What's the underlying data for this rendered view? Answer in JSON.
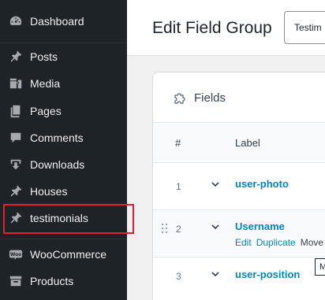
{
  "sidebar": {
    "items": [
      {
        "label": "Dashboard",
        "icon": "dashboard-icon"
      },
      {
        "label": "Posts",
        "icon": "pin-icon"
      },
      {
        "label": "Media",
        "icon": "media-icon"
      },
      {
        "label": "Pages",
        "icon": "pages-icon"
      },
      {
        "label": "Comments",
        "icon": "comment-icon"
      },
      {
        "label": "Downloads",
        "icon": "download-icon"
      },
      {
        "label": "Houses",
        "icon": "pin-icon"
      },
      {
        "label": "testimonials",
        "icon": "pin-icon"
      },
      {
        "label": "WooCommerce",
        "icon": "woocommerce-icon"
      },
      {
        "label": "Products",
        "icon": "archive-icon"
      }
    ],
    "highlight_color": "#e3202f"
  },
  "header": {
    "title": "Edit Field Group",
    "title_input_value": "Testim"
  },
  "panel": {
    "title": "Fields",
    "columns": {
      "num": "#",
      "label": "Label"
    },
    "rows": [
      {
        "num": "1",
        "label": "user-photo"
      },
      {
        "num": "2",
        "label": "Username",
        "actions": [
          "Edit",
          "Duplicate",
          "Move"
        ]
      },
      {
        "num": "3",
        "label": "user-position"
      }
    ],
    "tooltip_chip": "M"
  },
  "colors": {
    "sidebar_bg": "#1d2327",
    "link": "#0783be",
    "page_bg": "#f0f0f1"
  }
}
